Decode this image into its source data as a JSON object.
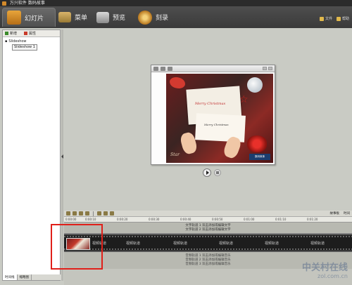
{
  "window": {
    "title": "万兴软件 数码故事"
  },
  "main_tabs": [
    {
      "label": "幻灯片",
      "active": true
    },
    {
      "label": "菜单"
    },
    {
      "label": "预览"
    },
    {
      "label": "刻录"
    }
  ],
  "top_right": {
    "file": "文件",
    "help": "帮助"
  },
  "left_panel": {
    "add_label": "新增",
    "props_label": "属性",
    "tree_root": "Slideshow",
    "tree_child": "Slideshow 1",
    "bottom_tabs": [
      "时间线",
      "缩略图"
    ]
  },
  "preview": {
    "greeting_main": "Merry Christmas",
    "greeting_small": "Merry Christmas",
    "logo_text": "数码故事",
    "corner_text": "Star"
  },
  "timeline": {
    "ruler": [
      "0:00:00",
      "0:00:10",
      "0:00:20",
      "0:00:30",
      "0:00:40",
      "0:00:50",
      "0:01:00",
      "0:01:10",
      "0:01:20"
    ],
    "right_labels": [
      "故事板",
      "时间"
    ],
    "text_track": [
      "文字轨道 1 双击添加或编辑文字",
      "文字轨道 2 双击添加或编辑文字"
    ],
    "video_label": "视频轨道",
    "audio_track": [
      "音频轨道 1 双击添加或编辑音乐",
      "音频轨道 2 双击添加或编辑音乐",
      "音频轨道 3 双击添加或编辑音乐"
    ]
  },
  "watermark": {
    "main": "中关村在线",
    "sub": "zol.com.cn"
  }
}
